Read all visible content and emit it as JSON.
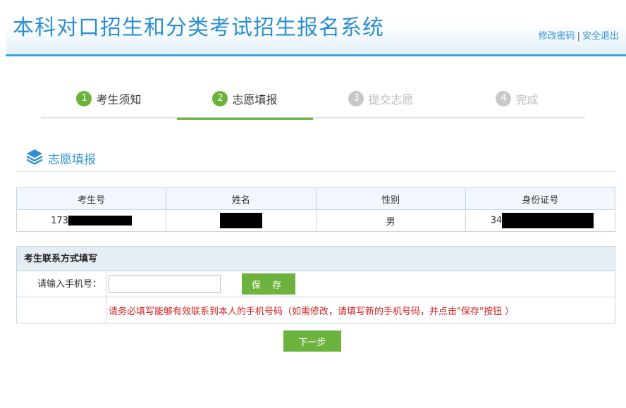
{
  "header": {
    "title": "本科对口招生和分类考试招生报名系统",
    "links": {
      "change_password": "修改密码",
      "separator": "|",
      "logout": "安全退出"
    }
  },
  "steps": [
    {
      "num": "1",
      "label": "考生须知",
      "state": "done"
    },
    {
      "num": "2",
      "label": "志愿填报",
      "state": "active"
    },
    {
      "num": "3",
      "label": "提交志愿",
      "state": "todo"
    },
    {
      "num": "4",
      "label": "完成",
      "state": "todo"
    }
  ],
  "section": {
    "title": "志愿填报",
    "icon": "layers-icon"
  },
  "info_table": {
    "headers": [
      "考生号",
      "姓名",
      "性别",
      "身份证号"
    ],
    "row": {
      "exam_no_prefix": "173",
      "name": "",
      "gender": "男",
      "id_prefix": "34"
    }
  },
  "contact": {
    "title": "考生联系方式填写",
    "phone_label": "请输入手机号：",
    "phone_value": "",
    "save_label": "保 存",
    "note": "请务必填写能够有效联系到本人的手机号码（如需修改，请填写新的手机号码，并点击\"保存\"按钮 ）"
  },
  "next_label": "下一步",
  "colors": {
    "brand_blue": "#2b8fd2",
    "accent_green": "#6cb33e",
    "note_red": "#d21e1e"
  }
}
